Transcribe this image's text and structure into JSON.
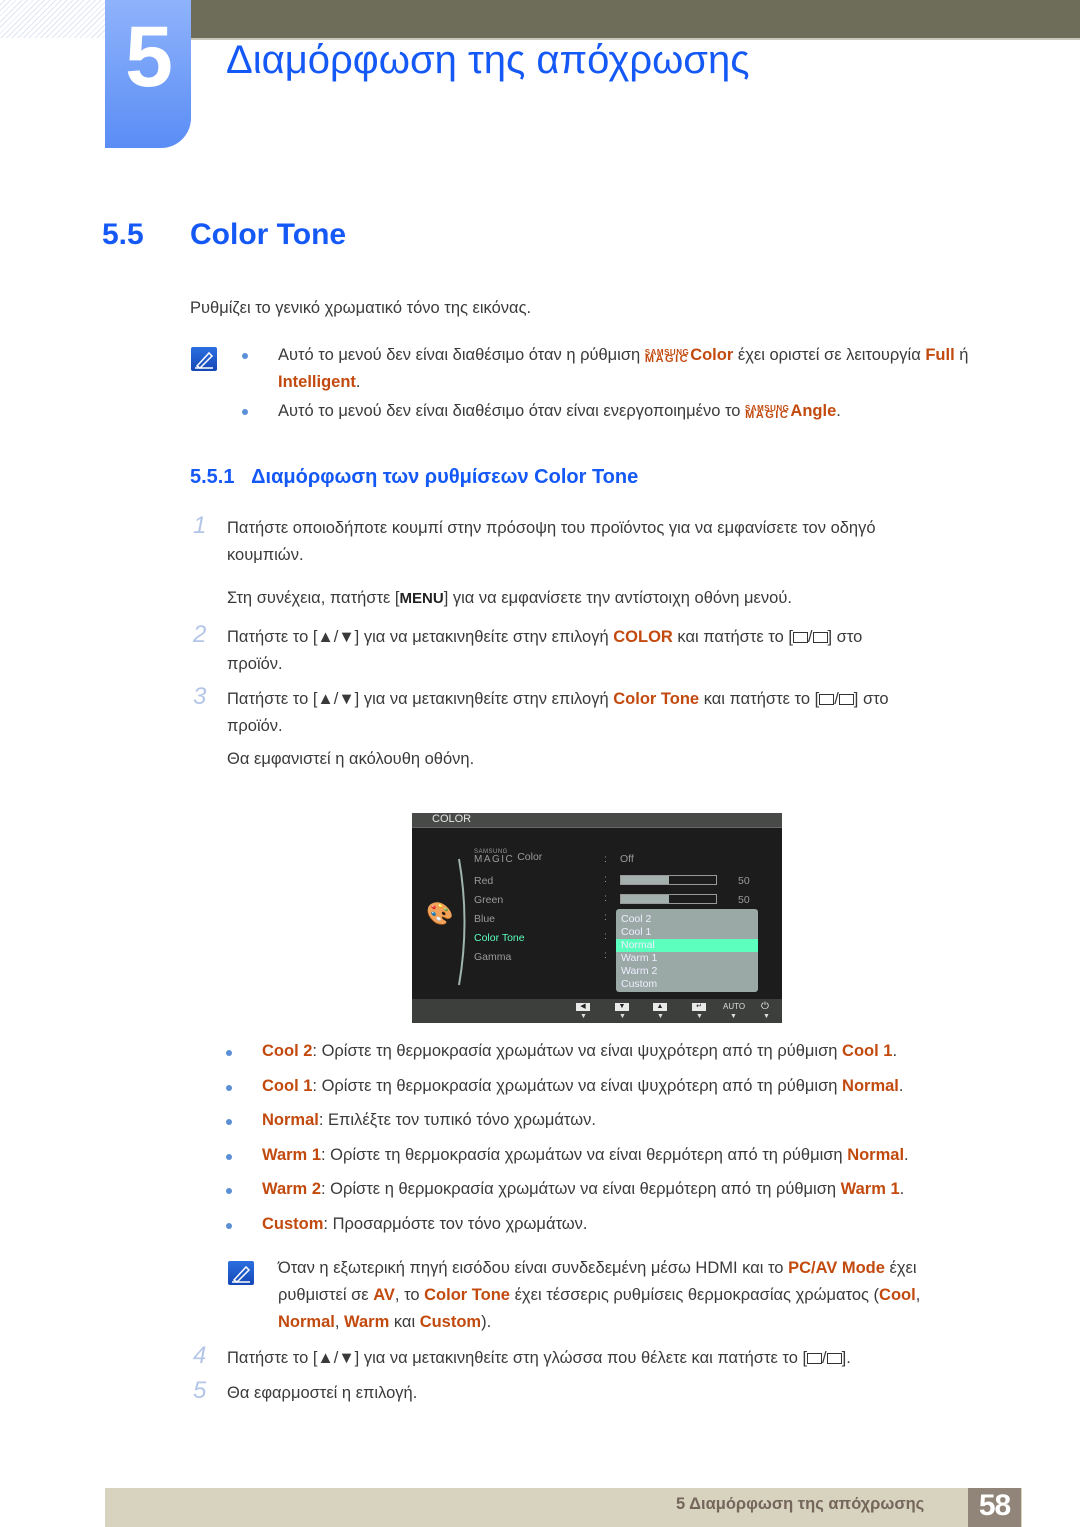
{
  "header": {
    "chapter_number": "5",
    "chapter_title": "Διαμόρφωση της απόχρωσης"
  },
  "section": {
    "number": "5.5",
    "title": "Color Tone",
    "intro": "Ρυθμίζει το γενικό χρωματικό τόνο της εικόνας."
  },
  "notes_top": {
    "note1": {
      "pre": "Αυτό το μενού δεν είναι διαθέσιμο όταν η ρύθμιση ",
      "magic_top": "SAMSUNG",
      "magic_bottom": "MAGIC",
      "term": "Color",
      "mid": " έχει οριστεί σε λειτουργία ",
      "opt1": "Full",
      "or": " ή",
      "opt2": "Intelligent",
      "end": "."
    },
    "note2": {
      "pre": "Αυτό το μενού δεν είναι διαθέσιμο όταν είναι ενεργοποιημένο το ",
      "magic_top": "SAMSUNG",
      "magic_bottom": "MAGIC",
      "term": "Angle",
      "end": "."
    }
  },
  "subsection": {
    "number": "5.5.1",
    "title": "Διαμόρφωση των ρυθμίσεων Color Tone"
  },
  "steps": [
    {
      "num": "1",
      "line1": "Πατήστε οποιοδήποτε κουμπί στην πρόσοψη του προϊόντος για να εμφανίσετε τον οδηγό",
      "line2": "κουμπιών.",
      "extra_pre": "Στη συνέχεια, πατήστε [",
      "extra_key": "MENU",
      "extra_post": "] για να εμφανίσετε την αντίστοιχη οθόνη μενού."
    },
    {
      "num": "2",
      "pre": "Πατήστε το [▲/▼] για να μετακινηθείτε στην επιλογή ",
      "term": "COLOR",
      "post": " και πατήστε το [",
      "post2": "] στο",
      "line2": "προϊόν."
    },
    {
      "num": "3",
      "pre": "Πατήστε το [▲/▼] για να μετακινηθείτε στην επιλογή ",
      "term": "Color Tone",
      "post": " και πατήστε το [",
      "post2": "] στο",
      "line2": "προϊόν.",
      "extra": "Θα εμφανιστεί η ακόλουθη οθόνη."
    },
    {
      "num": "4",
      "pre": "Πατήστε το [▲/▼] για να μετακινηθείτε στη γλώσσα που θέλετε και πατήστε το [",
      "post2": "]."
    },
    {
      "num": "5",
      "text": "Θα εφαρμοστεί η επιλογή."
    }
  ],
  "osd": {
    "title": "COLOR",
    "items": [
      {
        "magic_top": "SAMSUNG",
        "magic_bottom": "MAGIC",
        "label": "Color",
        "value": "Off"
      },
      {
        "label": "Red",
        "value": "50",
        "level": 0.5
      },
      {
        "label": "Green",
        "value": "50",
        "level": 0.5
      },
      {
        "label": "Blue"
      },
      {
        "label": "Color Tone",
        "selected": true
      },
      {
        "label": "Gamma"
      }
    ],
    "dropdown": [
      "Cool 2",
      "Cool 1",
      "Normal",
      "Warm 1",
      "Warm 2",
      "Custom"
    ],
    "dropdown_selected": "Normal",
    "footer_keys": [
      "◀",
      "▼",
      "▲",
      "↵",
      "AUTO",
      "⏻"
    ],
    "colors": {
      "selected_label": "#5cffbe",
      "selected_option_bg": "#5cffbe"
    }
  },
  "options": [
    {
      "term": "Cool 2",
      "desc": ": Ορίστε τη θερμοκρασία χρωμάτων να είναι ψυχρότερη από τη ρύθμιση ",
      "ref": "Cool 1",
      "end": "."
    },
    {
      "term": "Cool 1",
      "desc": ": Ορίστε τη θερμοκρασία χρωμάτων να είναι ψυχρότερη από τη ρύθμιση ",
      "ref": "Normal",
      "end": "."
    },
    {
      "term": "Normal",
      "desc": ": Επιλέξτε τον τυπικό τόνο χρωμάτων.",
      "ref": "",
      "end": ""
    },
    {
      "term": "Warm 1",
      "desc": ": Ορίστε τη θερμοκρασία χρωμάτων να είναι θερμότερη από τη ρύθμιση ",
      "ref": "Normal",
      "end": "."
    },
    {
      "term": "Warm 2",
      "desc": ": Ορίστε η θερμοκρασία χρωμάτων να είναι θερμότερη από τη ρύθμιση ",
      "ref": "Warm 1",
      "end": "."
    },
    {
      "term": "Custom",
      "desc": ": Προσαρμόστε τον τόνο χρωμάτων.",
      "ref": "",
      "end": ""
    }
  ],
  "note_bottom": {
    "t1": "Όταν η εξωτερική πηγή εισόδου είναι συνδεδεμένη μέσω HDMI και το ",
    "h1": "PC/AV Mode",
    "t2": " έχει",
    "t3": "ρυθμιστεί σε ",
    "h2": "AV",
    "t4": ", το ",
    "h3": "Color Tone",
    "t5": " έχει τέσσερις ρυθμίσεις θερμοκρασίας χρώματος (",
    "h4": "Cool",
    "t6": ",",
    "h5": "Normal",
    "t7": ", ",
    "h6": "Warm",
    "t8": " και ",
    "h7": "Custom",
    "t9": ")."
  },
  "footer": {
    "chapter_label": "5 Διαμόρφωση της απόχρωσης",
    "page_number": "58"
  },
  "colors": {
    "heading_blue": "#1458f6",
    "highlight_orange": "#c34a0e",
    "footer_band": "#d8d3bf",
    "page_box": "#918579",
    "top_bar": "#6e6d59"
  }
}
